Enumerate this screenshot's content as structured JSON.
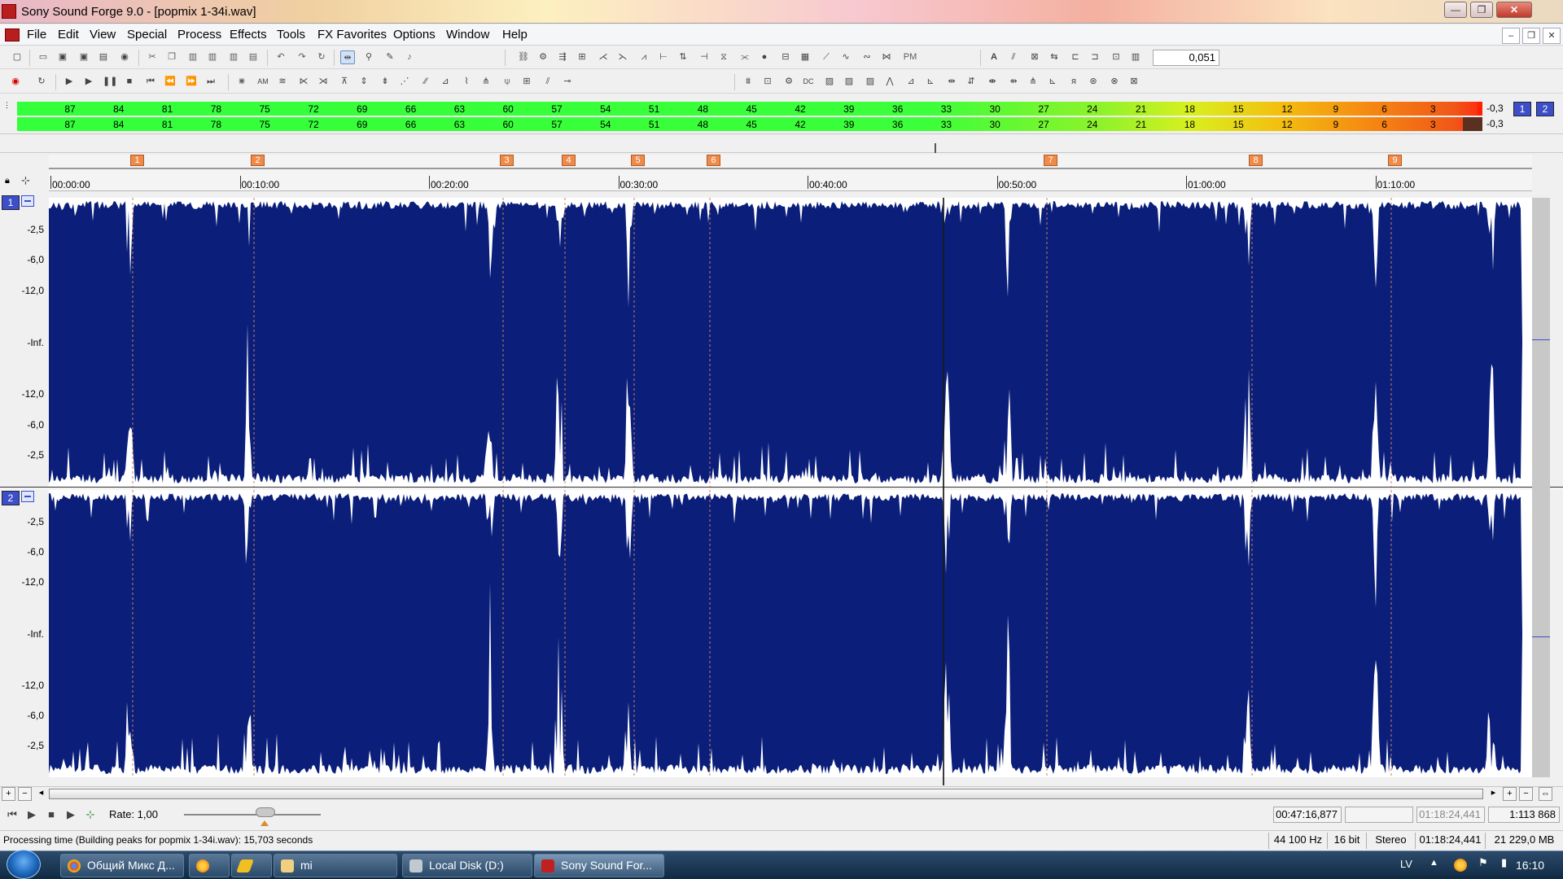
{
  "window": {
    "title": "Sony Sound Forge 9.0 - [popmix 1-34i.wav]",
    "minimize": "—",
    "maximize": "❐",
    "close": "✕"
  },
  "menu": {
    "items": [
      "File",
      "Edit",
      "View",
      "Special",
      "Process",
      "Effects",
      "Tools",
      "FX Favorites",
      "Options",
      "Window",
      "Help"
    ]
  },
  "doc_controls": {
    "minimize": "–",
    "restore": "❐",
    "close": "✕"
  },
  "toolbar": {
    "zoom_value": "0,051",
    "pm_label": "PM",
    "dc_label": "DC",
    "am_label": "AM"
  },
  "meters": {
    "scale": [
      "87",
      "84",
      "81",
      "78",
      "75",
      "72",
      "69",
      "66",
      "63",
      "60",
      "57",
      "54",
      "51",
      "48",
      "45",
      "42",
      "39",
      "36",
      "33",
      "30",
      "27",
      "24",
      "21",
      "18",
      "15",
      "12",
      "9",
      "6",
      "3"
    ],
    "left_peak": "-0,3",
    "right_peak": "-0,3",
    "buttons": [
      "1",
      "2"
    ]
  },
  "markers": [
    "1",
    "2",
    "3",
    "4",
    "5",
    "6",
    "7",
    "8",
    "9"
  ],
  "timeline": {
    "ticks": [
      "00:00:00",
      "00:10:00",
      "00:20:00",
      "00:30:00",
      "00:40:00",
      "00:50:00",
      "01:00:00",
      "01:10:00"
    ]
  },
  "channels": [
    {
      "number": "1",
      "db_labels": [
        "-2,5",
        "-6,0",
        "-12,0",
        "-Inf.",
        "-12,0",
        "-6,0",
        "-2,5"
      ]
    },
    {
      "number": "2",
      "db_labels": [
        "-2,5",
        "-6,0",
        "-12,0",
        "-Inf.",
        "-12,0",
        "-6,0",
        "-2,5"
      ]
    }
  ],
  "transport": {
    "rate_label": "Rate: 1,00"
  },
  "selection": {
    "cursor_time": "00:47:16,877",
    "end_time": "01:18:24,441",
    "zoom_ratio": "1:113 868"
  },
  "status": {
    "message": "Processing time (Building peaks for popmix 1-34i.wav): 15,703 seconds",
    "sample_rate": "44 100 Hz",
    "bit_depth": "16 bit",
    "channels": "Stereo",
    "length": "01:18:24,441",
    "disk_space": "21 229,0 MB"
  },
  "taskbar": {
    "tasks": [
      "Общий Микс Д...",
      "",
      "",
      "mi",
      "Local Disk (D:)",
      "Sony Sound For..."
    ],
    "lang": "LV",
    "clock": "16:10"
  },
  "colors": {
    "wave_bg": "#0a1e7a",
    "wave_fg": "#ffffff",
    "marker": "#ee8a4a",
    "meter_green": "#33ff3a"
  }
}
